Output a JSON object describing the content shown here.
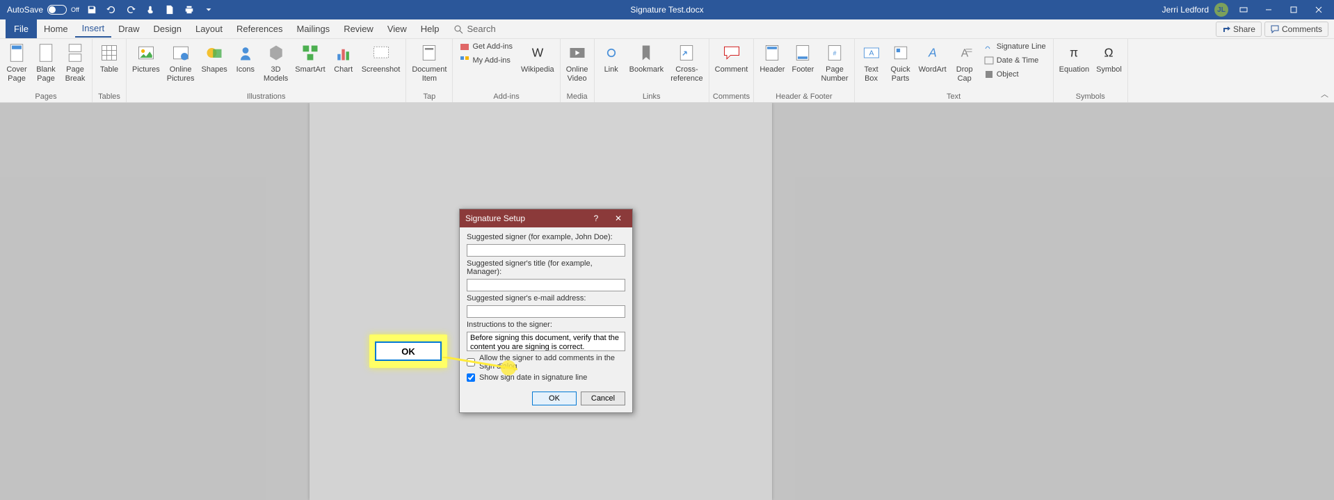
{
  "titlebar": {
    "autosave_label": "AutoSave",
    "autosave_state": "Off",
    "doc_title": "Signature Test.docx",
    "user_name": "Jerri Ledford",
    "user_initials": "JL"
  },
  "tabs": {
    "file": "File",
    "home": "Home",
    "insert": "Insert",
    "draw": "Draw",
    "design": "Design",
    "layout": "Layout",
    "references": "References",
    "mailings": "Mailings",
    "review": "Review",
    "view": "View",
    "help": "Help",
    "search": "Search"
  },
  "menubar_right": {
    "share": "Share",
    "comments": "Comments"
  },
  "ribbon": {
    "pages": {
      "cover": "Cover\nPage",
      "blank": "Blank\nPage",
      "break": "Page\nBreak",
      "label": "Pages"
    },
    "tables": {
      "table": "Table",
      "label": "Tables"
    },
    "illustrations": {
      "pictures": "Pictures",
      "online_pictures": "Online\nPictures",
      "shapes": "Shapes",
      "icons": "Icons",
      "models": "3D\nModels",
      "smartart": "SmartArt",
      "chart": "Chart",
      "screenshot": "Screenshot",
      "label": "Illustrations"
    },
    "tap": {
      "doc_item": "Document\nItem",
      "label": "Tap"
    },
    "addins": {
      "get": "Get Add-ins",
      "my": "My Add-ins",
      "wikipedia": "Wikipedia",
      "label": "Add-ins"
    },
    "media": {
      "video": "Online\nVideo",
      "label": "Media"
    },
    "links": {
      "link": "Link",
      "bookmark": "Bookmark",
      "crossref": "Cross-\nreference",
      "label": "Links"
    },
    "comments": {
      "comment": "Comment",
      "label": "Comments"
    },
    "headerfooter": {
      "header": "Header",
      "footer": "Footer",
      "pagenum": "Page\nNumber",
      "label": "Header & Footer"
    },
    "text": {
      "textbox": "Text\nBox",
      "quickparts": "Quick\nParts",
      "wordart": "WordArt",
      "dropcap": "Drop\nCap",
      "sigline": "Signature Line",
      "datetime": "Date & Time",
      "object": "Object",
      "label": "Text"
    },
    "symbols": {
      "equation": "Equation",
      "symbol": "Symbol",
      "label": "Symbols"
    }
  },
  "dialog": {
    "title": "Signature Setup",
    "signer_label": "Suggested signer (for example, John Doe):",
    "signer_value": "",
    "title_label": "Suggested signer's title (for example, Manager):",
    "title_value": "",
    "email_label": "Suggested signer's e-mail address:",
    "email_value": "",
    "instructions_label": "Instructions to the signer:",
    "instructions_value": "Before signing this document, verify that the content you are signing is correct.",
    "allow_comments": "Allow the signer to add comments in the Sign dialog",
    "show_date": "Show sign date in signature line",
    "ok": "OK",
    "cancel": "Cancel"
  },
  "callout": {
    "ok": "OK"
  }
}
